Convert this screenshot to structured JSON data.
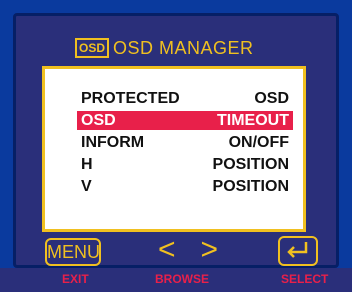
{
  "header": {
    "logo_text": "OSD",
    "title": "OSD MANAGER"
  },
  "menu": {
    "rows": [
      {
        "left": "PROTECTED",
        "right": "OSD",
        "selected": false
      },
      {
        "left": "OSD",
        "right": "TIMEOUT",
        "selected": true
      },
      {
        "left": "INFORM",
        "right": "ON/OFF",
        "selected": false
      },
      {
        "left": "H",
        "right": "POSITION",
        "selected": false
      },
      {
        "left": "V",
        "right": "POSITION",
        "selected": false
      }
    ]
  },
  "controls": {
    "menu_button": "MENU",
    "browse_left": "<",
    "browse_right": ">",
    "select_icon": "enter-icon",
    "exit_label": "EXIT",
    "browse_label": "BROWSE",
    "select_label": "SELECT"
  },
  "colors": {
    "accent": "#f0c020",
    "highlight": "#e8204a",
    "bezel": "#0a3a9e"
  }
}
